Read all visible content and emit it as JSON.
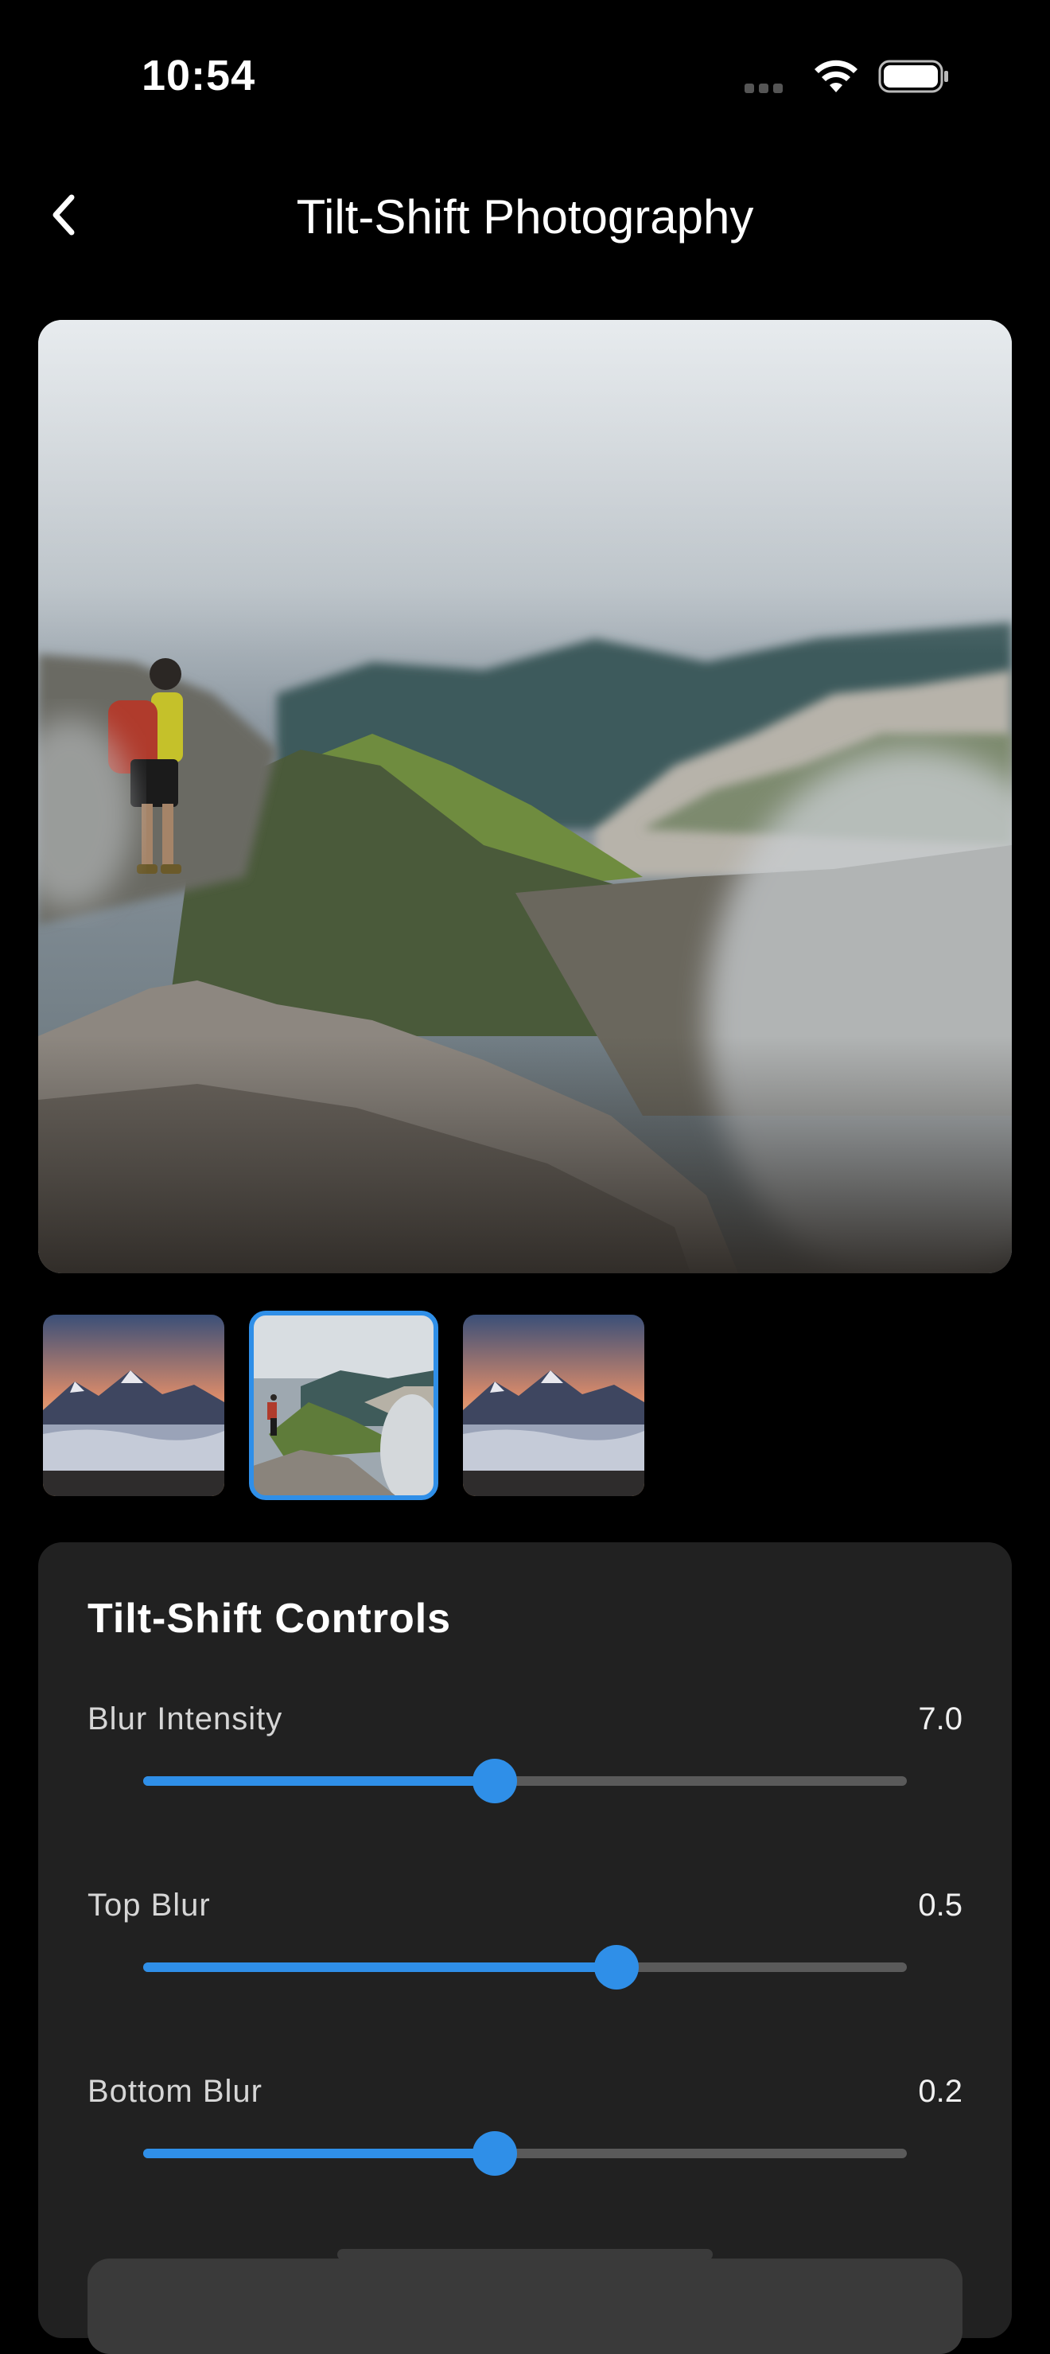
{
  "status_bar": {
    "time": "10:54"
  },
  "nav": {
    "title": "Tilt-Shift Photography",
    "back_icon": "chevron-left-icon"
  },
  "thumbnails": [
    {
      "name": "mountain-sea-of-clouds",
      "selected": false
    },
    {
      "name": "hiker-on-ridge",
      "selected": true
    },
    {
      "name": "mountain-sea-of-clouds",
      "selected": false
    }
  ],
  "controls": {
    "title": "Tilt-Shift Controls",
    "blur_intensity": {
      "label": "Blur Intensity",
      "value": "7.0",
      "fraction": 0.46
    },
    "top_blur": {
      "label": "Top Blur",
      "value": "0.5",
      "fraction": 0.62
    },
    "bottom_blur": {
      "label": "Bottom Blur",
      "value": "0.2",
      "fraction": 0.46
    }
  },
  "colors": {
    "accent": "#2f8fe8",
    "panel": "#212121",
    "background": "#000000"
  }
}
